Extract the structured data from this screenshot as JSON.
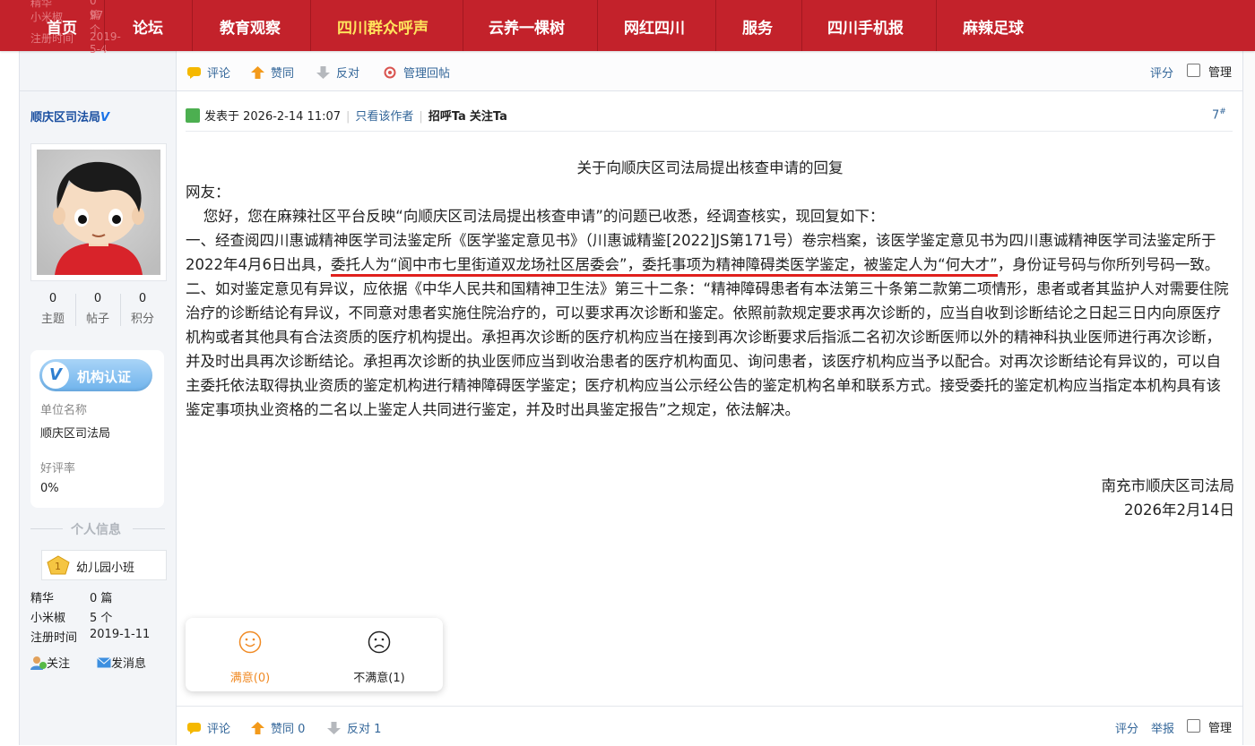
{
  "nav": {
    "items": [
      "首页",
      "论坛",
      "教育观察",
      "四川群众呼声",
      "云养一棵树",
      "网红四川",
      "服务",
      "四川手机报",
      "麻辣足球"
    ],
    "active_index": 3,
    "ghost_rows": [
      {
        "label": "精华",
        "value": "0 篇"
      },
      {
        "label": "小米椒",
        "value": "97 个"
      },
      {
        "label": "注册时间",
        "value": "2019-5-4"
      }
    ]
  },
  "prev_post_bar": {
    "comment": "评论",
    "agree": "赞同",
    "oppose": "反对",
    "manage_reply": "管理回帖",
    "score": "评分",
    "manage": "管理"
  },
  "author": {
    "name": "顺庆区司法局",
    "verified_mark": "V",
    "stats": [
      {
        "value": "0",
        "label": "主题"
      },
      {
        "value": "0",
        "label": "帖子"
      },
      {
        "value": "0",
        "label": "积分"
      }
    ],
    "org_badge": "机构认证",
    "org_name_label": "单位名称",
    "org_name": "顺庆区司法局",
    "rating_label": "好评率",
    "rating_value": "0%",
    "personal_info_title": "个人信息",
    "rank": "幼儿园小班",
    "meta": [
      {
        "label": "精华",
        "value": "0 篇"
      },
      {
        "label": "小米椒",
        "value": "5 个"
      },
      {
        "label": "注册时间",
        "value": "2019-1-11"
      }
    ],
    "follow": "关注",
    "message": "发消息"
  },
  "post": {
    "posted_at": "发表于 2026-2-14 11:07",
    "only_author": "只看该作者",
    "greet": "招呼Ta",
    "follow": "关注Ta",
    "floor": "7",
    "floor_sup": "#",
    "title": "关于向顺庆区司法局提出核查申请的回复",
    "salutation": "网友：",
    "intro": "您好，您在麻辣社区平台反映“向顺庆区司法局提出核查申请”的问题已收悉，经调查核实，现回复如下：",
    "para1_a": "一、经查阅四川惠诚精神医学司法鉴定所《医学鉴定意见书》（川惠诚精鉴[2022]JS第171号）卷宗档案，该医学鉴定意见书为四川惠诚精神医学司法鉴定所于2022年4月6日出具，",
    "para1_u": "委托人为“阆中市七里街道双龙场社区居委会”，委托事项为精神障碍类医学鉴定，被鉴定人为“何大才”",
    "para1_b": "，身份证号码与你所列号码一致。",
    "para2": "二、如对鉴定意见有异议，应依据《中华人民共和国精神卫生法》第三十二条：“精神障碍患者有本法第三十条第二款第二项情形，患者或者其监护人对需要住院治疗的诊断结论有异议，不同意对患者实施住院治疗的，可以要求再次诊断和鉴定。依照前款规定要求再次诊断的，应当自收到诊断结论之日起三日内向原医疗机构或者其他具有合法资质的医疗机构提出。承担再次诊断的医疗机构应当在接到再次诊断要求后指派二名初次诊断医师以外的精神科执业医师进行再次诊断，并及时出具再次诊断结论。承担再次诊断的执业医师应当到收治患者的医疗机构面见、询问患者，该医疗机构应当予以配合。对再次诊断结论有异议的，可以自主委托依法取得执业资质的鉴定机构进行精神障碍医学鉴定；医疗机构应当公示经公告的鉴定机构名单和联系方式。接受委托的鉴定机构应当指定本机构具有该鉴定事项执业资格的二名以上鉴定人共同进行鉴定，并及时出具鉴定报告”之规定，依法解决。",
    "signature": "南充市顺庆区司法局",
    "date": "2026年2月14日"
  },
  "rating": {
    "satisfied": "满意(0)",
    "unsatisfied": "不满意(1)",
    "satisfied_color": "#f08a24"
  },
  "post_bar": {
    "comment": "评论",
    "agree": "赞同 0",
    "oppose": "反对 1",
    "score": "评分",
    "report": "举报",
    "manage": "管理"
  },
  "colors": {
    "nav_bg": "#c3222b",
    "nav_active": "#ffe35c",
    "link": "#336699",
    "underline": "#e0201d"
  }
}
